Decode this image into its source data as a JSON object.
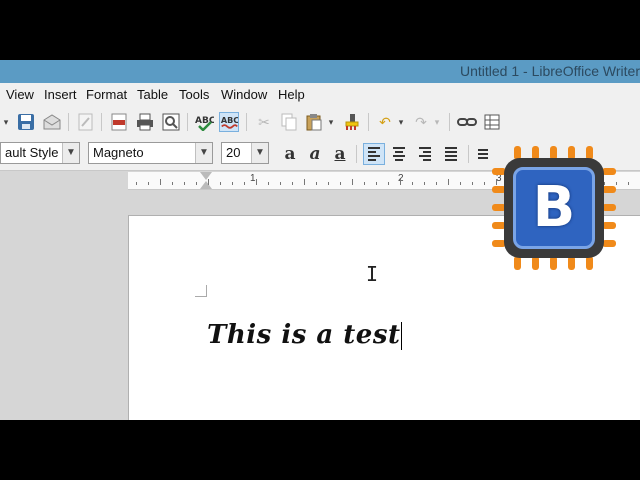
{
  "window": {
    "title": "Untitled 1 - LibreOffice Writer"
  },
  "menu": {
    "items": [
      {
        "label": "View",
        "accel": "V"
      },
      {
        "label": "Insert",
        "accel": "I"
      },
      {
        "label": "Format",
        "accel": "o"
      },
      {
        "label": "Table",
        "accel": "a"
      },
      {
        "label": "Tools",
        "accel": "T"
      },
      {
        "label": "Window",
        "accel": "W"
      },
      {
        "label": "Help",
        "accel": "H"
      }
    ]
  },
  "formatting": {
    "paragraph_style": "ault Style",
    "font_name": "Magneto",
    "font_size": "20"
  },
  "icons": {
    "save": "save-icon",
    "email": "email-icon",
    "edit": "edit-icon",
    "pdf": "pdf-icon",
    "print": "print-icon",
    "print_preview": "print-preview-icon",
    "spellcheck": "spellcheck-icon",
    "autospell": "autospell-icon",
    "cut": "cut-icon",
    "copy": "copy-icon",
    "paste": "paste-icon",
    "clone": "clone-formatting-icon",
    "undo": "undo-icon",
    "redo": "redo-icon",
    "hyperlink": "hyperlink-icon",
    "table": "table-icon"
  },
  "ruler": {
    "labels": [
      "1",
      "2",
      "3"
    ]
  },
  "document": {
    "text": "This is a test"
  },
  "logo": {
    "letter": "B",
    "colors": {
      "pins": "#f08a1a",
      "face": "#2f64c0",
      "body": "#3a3a3a"
    }
  },
  "colors": {
    "titlebar": "#5b9bc4",
    "toolbar": "#f0f0f0",
    "workspace": "#d6d6d6",
    "pressed": "#cfe4f7"
  }
}
